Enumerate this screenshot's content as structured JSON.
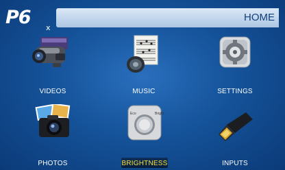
{
  "brand": {
    "logo": "P6",
    "logo_sub": "x"
  },
  "header": {
    "title": "HOME"
  },
  "menu": [
    {
      "label": "VIDEOS",
      "icon": "video-camera-icon"
    },
    {
      "label": "MUSIC",
      "icon": "music-icon"
    },
    {
      "label": "SETTINGS",
      "icon": "settings-gear-icon"
    },
    {
      "label": "PHOTOS",
      "icon": "photo-camera-icon"
    },
    {
      "label": "BRIGHTNESS",
      "icon": "brightness-knob-icon",
      "selected": true,
      "knob_left": "Eco",
      "knob_right": "Bright"
    },
    {
      "label": "INPUTS",
      "icon": "hdmi-input-icon"
    }
  ],
  "colors": {
    "background": "#15539a",
    "header_text": "#123f7c",
    "label": "#ffffff",
    "selected_label": "#f6e23a"
  }
}
